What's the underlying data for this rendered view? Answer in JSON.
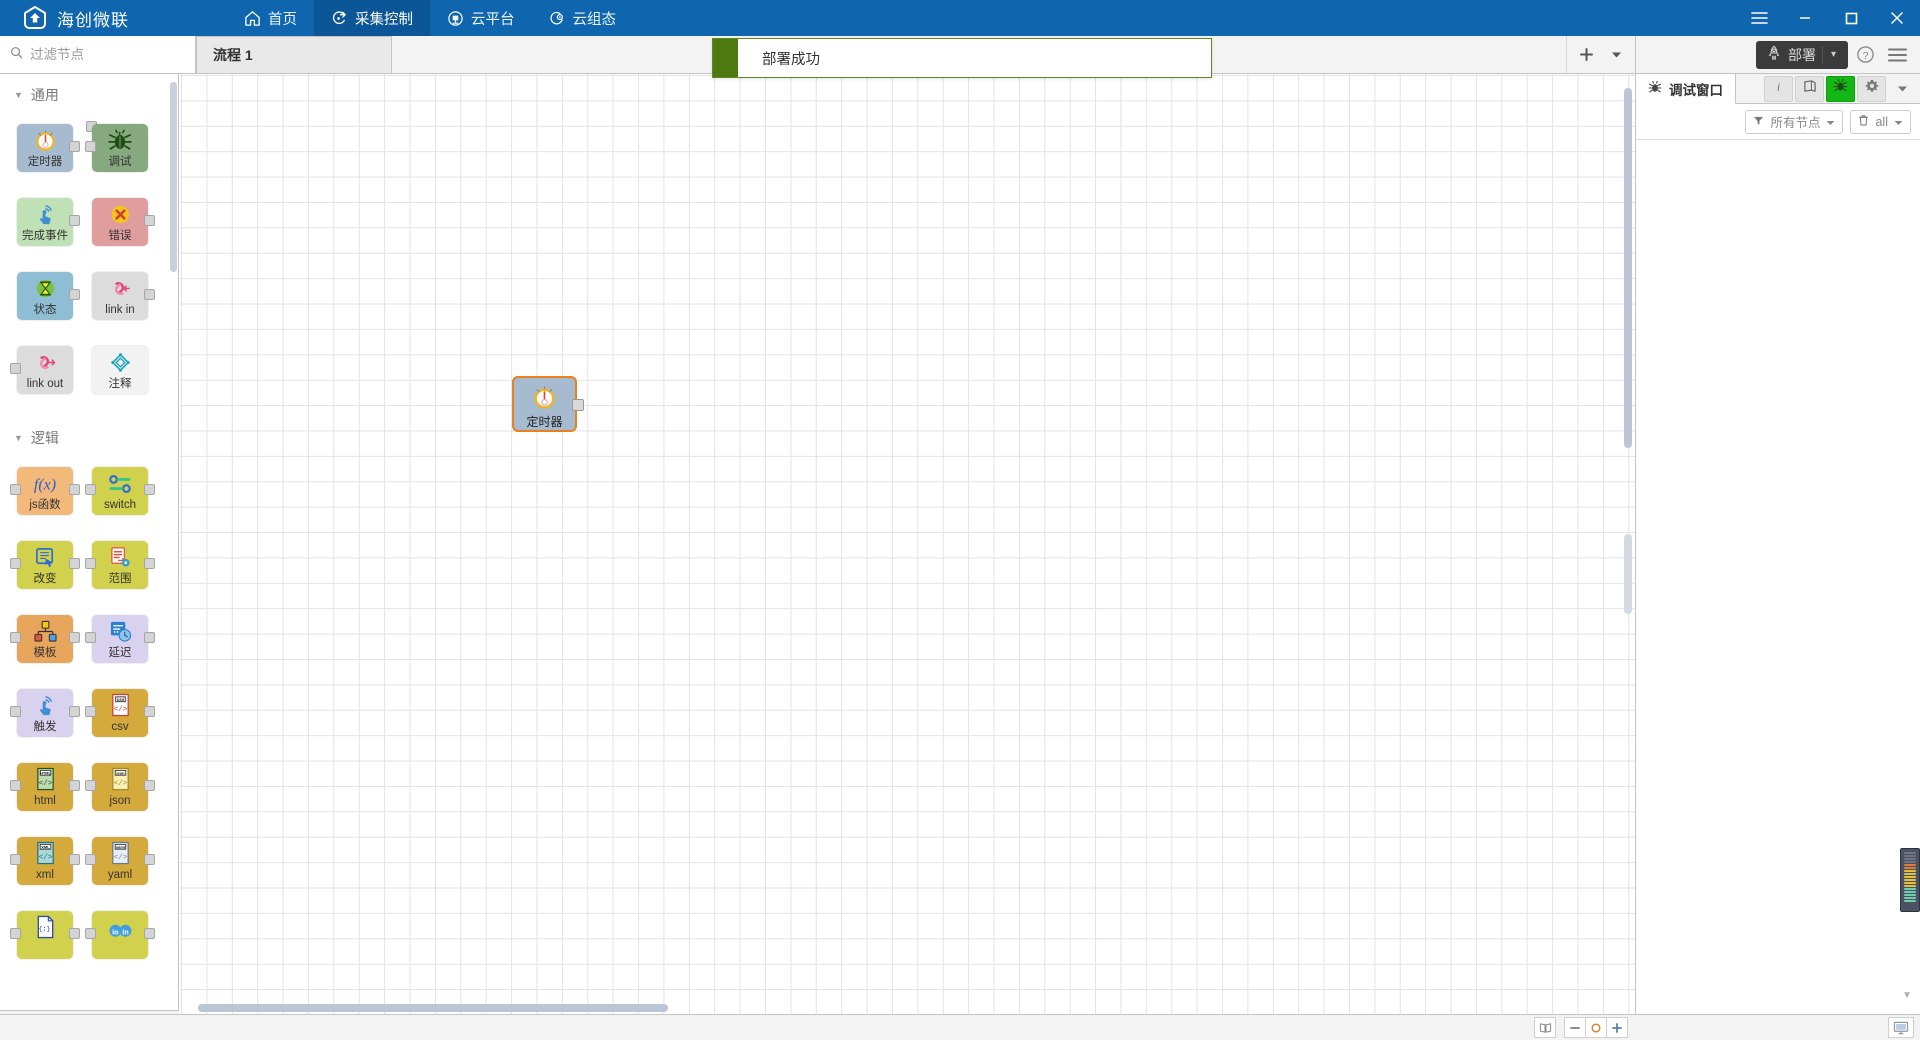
{
  "titlebar": {
    "brand": "海创微联",
    "brand_icon": "house-shield-logo",
    "nav": [
      {
        "label": "首页",
        "icon": "home-icon",
        "active": false
      },
      {
        "label": "采集控制",
        "icon": "collect-control-icon",
        "active": true
      },
      {
        "label": "云平台",
        "icon": "cloud-platform-icon",
        "active": false
      },
      {
        "label": "云组态",
        "icon": "cloud-scada-icon",
        "active": false
      }
    ],
    "window_controls": [
      {
        "name": "menu-icon",
        "glyph": "≡"
      },
      {
        "name": "minimize-icon",
        "glyph": "–"
      },
      {
        "name": "maximize-icon",
        "glyph": "❐"
      },
      {
        "name": "close-icon",
        "glyph": "✕"
      }
    ],
    "bg_color": "#0f66ae"
  },
  "header": {
    "filter_placeholder": "过滤节点",
    "filter_value": "",
    "tabs": [
      {
        "label": "流程 1",
        "active": true
      }
    ],
    "tab_add_label": "+",
    "tab_menu_label": "▾",
    "deploy_label": "部署",
    "deploy_caret": "▾",
    "help_label": "?",
    "menu_label": "≡"
  },
  "notification": {
    "message": "部署成功",
    "accent_color": "#4d7a10",
    "border_color": "#5f8a22"
  },
  "palette": {
    "categories": [
      {
        "name": "通用",
        "nodes": [
          {
            "label": "定时器",
            "icon": "timer-clock-icon",
            "color": "#a6bbcf",
            "ports": "out"
          },
          {
            "label": "调试",
            "icon": "bug-icon",
            "color": "#87a980",
            "ports": "in"
          },
          {
            "label": "完成事件",
            "icon": "complete-touch-icon",
            "color": "#c0e0b6",
            "ports": "out"
          },
          {
            "label": "错误",
            "icon": "error-x-icon",
            "color": "#e09d9d",
            "ports": "out"
          },
          {
            "label": "状态",
            "icon": "status-hourglass-icon",
            "color": "#8fbdd4",
            "ports": "out"
          },
          {
            "label": "link in",
            "icon": "link-in-icon",
            "color": "#dcdcdc",
            "ports": "out"
          },
          {
            "label": "link out",
            "icon": "link-out-icon",
            "color": "#dcdcdc",
            "ports": "in"
          },
          {
            "label": "注释",
            "icon": "comment-icon",
            "color": "#f2f2f2",
            "ports": "none"
          }
        ]
      },
      {
        "name": "逻辑",
        "nodes": [
          {
            "label": "js函数",
            "icon": "fx-function-icon",
            "color": "#f3b97a",
            "ports": "both"
          },
          {
            "label": "switch",
            "icon": "switch-toggle-icon",
            "color": "#d1d14e",
            "ports": "both"
          },
          {
            "label": "改变",
            "icon": "change-edit-icon",
            "color": "#d1d14e",
            "ports": "both"
          },
          {
            "label": "范围",
            "icon": "range-gear-icon",
            "color": "#d1d14e",
            "ports": "both"
          },
          {
            "label": "模板",
            "icon": "template-tree-icon",
            "color": "#e8a55c",
            "ports": "both"
          },
          {
            "label": "延迟",
            "icon": "delay-clock-icon",
            "color": "#d9d2ef",
            "ports": "both"
          },
          {
            "label": "触发",
            "icon": "trigger-touch-icon",
            "color": "#d9d2ef",
            "ports": "both"
          },
          {
            "label": "csv",
            "icon": "csv-file-icon",
            "color": "#d4aa3c",
            "ports": "both"
          },
          {
            "label": "html",
            "icon": "html-file-icon",
            "color": "#d4aa3c",
            "ports": "both"
          },
          {
            "label": "json",
            "icon": "json-file-icon",
            "color": "#d4aa3c",
            "ports": "both"
          },
          {
            "label": "xml",
            "icon": "xml-file-icon",
            "color": "#d4aa3c",
            "ports": "both"
          },
          {
            "label": "yaml",
            "icon": "yaml-file-icon",
            "color": "#d4aa3c",
            "ports": "both"
          },
          {
            "label": "",
            "icon": "braces-file-icon",
            "color": "#d1d14e",
            "ports": "both"
          },
          {
            "label": "",
            "icon": "io-in-icon",
            "color": "#d1d14e",
            "ports": "both"
          }
        ]
      }
    ],
    "footer_buttons": [
      {
        "name": "collapse-all-button",
        "glyph": "⌃"
      },
      {
        "name": "expand-all-button",
        "glyph": "⌄"
      }
    ]
  },
  "canvas": {
    "node": {
      "label": "定时器",
      "icon": "timer-clock-icon",
      "color": "#a6bbcf",
      "selected": true,
      "select_color": "#e8811b"
    },
    "controls": [
      {
        "name": "navigator-button",
        "glyph": "navigator-icon"
      },
      {
        "name": "zoom-out-button",
        "glyph": "–"
      },
      {
        "name": "zoom-reset-button",
        "glyph": "○"
      },
      {
        "name": "zoom-in-button",
        "glyph": "+"
      }
    ]
  },
  "sidebar": {
    "title": "调试窗口",
    "title_icon": "bug-icon",
    "tools": [
      {
        "name": "info-tab",
        "glyph": "i",
        "active": false
      },
      {
        "name": "help-book-tab",
        "glyph": "book-icon",
        "active": false
      },
      {
        "name": "debug-tab",
        "glyph": "bug-icon",
        "active": true
      },
      {
        "name": "config-tab",
        "glyph": "gear-icon",
        "active": false
      },
      {
        "name": "more-tabs-caret",
        "glyph": "▾",
        "active": false
      }
    ],
    "filter_label": "所有节点",
    "filter_icon": "funnel-icon",
    "clear_label": "all",
    "clear_icon": "trash-icon",
    "messages": []
  },
  "footer": {
    "monitor_icon": "monitor-icon"
  },
  "edge_meter": {
    "name": "level-meter-widget",
    "segments": [
      "#6f7585",
      "#6f7585",
      "#6f7585",
      "#6f7585",
      "#e07b3c",
      "#e07b3c",
      "#e0c13c",
      "#e0c13c",
      "#e0c13c",
      "#e0c13c",
      "#e0c13c",
      "#e0c13c",
      "#6fd0b0",
      "#6fd0b0",
      "#6fd0b0",
      "#6fd0b0",
      "#6fd0b0"
    ]
  }
}
